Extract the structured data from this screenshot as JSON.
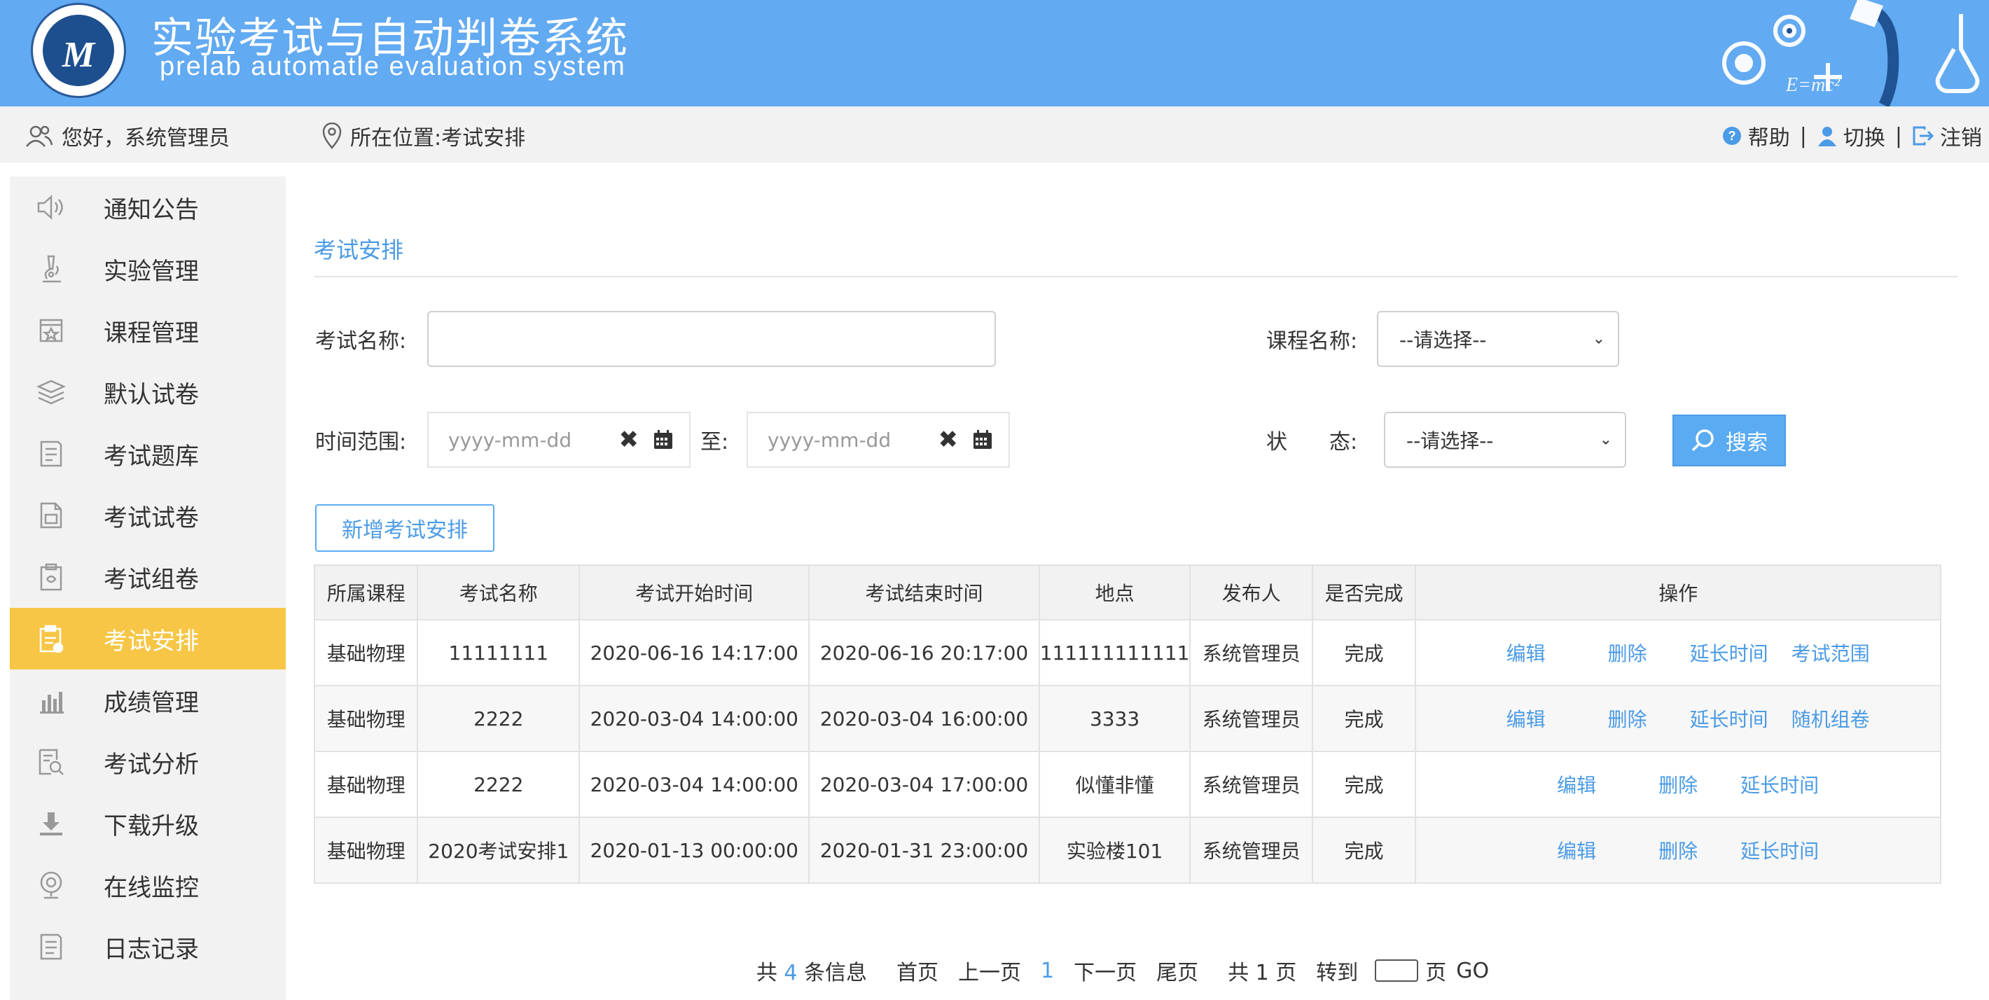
{
  "header": {
    "logo_mark": "M",
    "title_cn": "实验考试与自动判卷系统",
    "title_en": "prelab automatle evaluation system"
  },
  "topbar": {
    "greeting": "您好，系统管理员",
    "location": "所在位置:考试安排",
    "help": "帮助",
    "switch": "切换",
    "logout": "注销",
    "sep": "|"
  },
  "sidebar": {
    "items": [
      {
        "label": "通知公告",
        "icon": "speaker-icon"
      },
      {
        "label": "实验管理",
        "icon": "microscope-icon"
      },
      {
        "label": "课程管理",
        "icon": "course-icon"
      },
      {
        "label": "默认试卷",
        "icon": "stack-icon"
      },
      {
        "label": "考试题库",
        "icon": "doc-list-icon"
      },
      {
        "label": "考试试卷",
        "icon": "paper-icon"
      },
      {
        "label": "考试组卷",
        "icon": "clipboard-icon"
      },
      {
        "label": "考试安排",
        "icon": "schedule-icon",
        "active": true
      },
      {
        "label": "成绩管理",
        "icon": "bar-chart-icon"
      },
      {
        "label": "考试分析",
        "icon": "analysis-icon"
      },
      {
        "label": "下载升级",
        "icon": "download-icon"
      },
      {
        "label": "在线监控",
        "icon": "camera-icon"
      },
      {
        "label": "日志记录",
        "icon": "log-icon"
      }
    ]
  },
  "main": {
    "heading": "考试安排",
    "filters": {
      "exam_name_label": "考试名称:",
      "exam_name_value": "",
      "course_label": "课程名称:",
      "course_value": "--请选择--",
      "time_label": "时间范围:",
      "date_from_placeholder": "yyyy-mm-dd",
      "to_label": "至:",
      "date_to_placeholder": "yyyy-mm-dd",
      "status_label": "状　　态:",
      "status_value": "--请选择--",
      "search_label": "搜索"
    },
    "add_button": "新增考试安排",
    "table": {
      "headers": [
        "所属课程",
        "考试名称",
        "考试开始时间",
        "考试结束时间",
        "地点",
        "发布人",
        "是否完成",
        "操作"
      ],
      "rows": [
        {
          "course": "基础物理",
          "name": "11111111",
          "start": "2020-06-16 14:17:00",
          "end": "2020-06-16 20:17:00",
          "place": "111111111111",
          "publisher": "系统管理员",
          "done": "完成",
          "ops": [
            "编辑",
            "删除",
            "延长时间",
            "考试范围"
          ]
        },
        {
          "course": "基础物理",
          "name": "2222",
          "start": "2020-03-04 14:00:00",
          "end": "2020-03-04 16:00:00",
          "place": "3333",
          "publisher": "系统管理员",
          "done": "完成",
          "ops": [
            "编辑",
            "删除",
            "延长时间",
            "随机组卷"
          ]
        },
        {
          "course": "基础物理",
          "name": "2222",
          "start": "2020-03-04 14:00:00",
          "end": "2020-03-04 17:00:00",
          "place": "似懂非懂",
          "publisher": "系统管理员",
          "done": "完成",
          "ops": [
            "编辑",
            "删除",
            "延长时间"
          ]
        },
        {
          "course": "基础物理",
          "name": "2020考试安排1",
          "start": "2020-01-13 00:00:00",
          "end": "2020-01-31 23:00:00",
          "place": "实验楼101",
          "publisher": "系统管理员",
          "done": "完成",
          "ops": [
            "编辑",
            "删除",
            "延长时间"
          ]
        }
      ]
    },
    "pager": {
      "total_prefix": "共",
      "total_count": "4",
      "total_suffix": "条信息",
      "first": "首页",
      "prev": "上一页",
      "current": "1",
      "next": "下一页",
      "last": "尾页",
      "pages_text": "共 1 页",
      "goto_label": "转到",
      "page_unit": "页",
      "go": "GO"
    }
  },
  "colors": {
    "header_bg": "#62aaf1",
    "accent": "#4b9be6",
    "active_menu": "#f7c646"
  }
}
